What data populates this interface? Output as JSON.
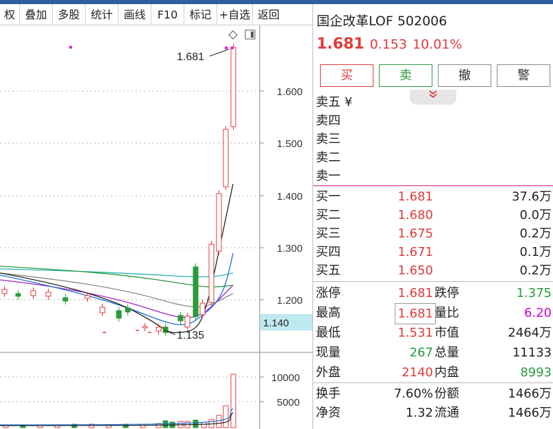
{
  "toolbar": {
    "items": [
      "权",
      "叠加",
      "多股",
      "统计",
      "画线",
      "F10",
      "标记",
      "+自选",
      "返回"
    ]
  },
  "chart": {
    "price_labels": [
      "1.600",
      "1.500",
      "1.400",
      "1.300",
      "1.200"
    ],
    "current_price_label": "1.140",
    "high_marker": "1.681",
    "low_marker": "1.135",
    "volume_labels": [
      "10000",
      "5000"
    ],
    "colors": {
      "up": "#e03a3a",
      "down": "#2a9a3a",
      "ma1": "#222222",
      "ma2": "#1a6fd8",
      "ma3": "#a020c0",
      "ma4": "#888888",
      "ma5": "#2ab0b0",
      "ma6": "#2a9a3a",
      "marker": "#e020e0"
    }
  },
  "chart_data": {
    "type": "candlestick",
    "ylim": [
      1.135,
      1.681
    ],
    "y_ticks": [
      1.6,
      1.5,
      1.4,
      1.3,
      1.2
    ],
    "visible_high": 1.681,
    "visible_low": 1.135,
    "volume_ticks": [
      10000,
      5000
    ]
  },
  "panel": {
    "title": "国企改革LOF 502006",
    "price": "1.681",
    "change": "0.153",
    "pct": "10.01%",
    "buttons": {
      "buy": "买",
      "sell": "卖",
      "cancel": "撤",
      "alert": "警"
    },
    "collapse_icon": "chevron-double-down",
    "asks": [
      {
        "label": "卖五 ¥",
        "price": "",
        "vol": ""
      },
      {
        "label": "卖四",
        "price": "",
        "vol": ""
      },
      {
        "label": "卖三",
        "price": "",
        "vol": ""
      },
      {
        "label": "卖二",
        "price": "",
        "vol": ""
      },
      {
        "label": "卖一",
        "price": "",
        "vol": ""
      }
    ],
    "bids": [
      {
        "label": "买一",
        "price": "1.681",
        "vol": "37.6万"
      },
      {
        "label": "买二",
        "price": "1.680",
        "vol": "0.0万"
      },
      {
        "label": "买三",
        "price": "1.675",
        "vol": "0.2万"
      },
      {
        "label": "买四",
        "price": "1.671",
        "vol": "0.1万"
      },
      {
        "label": "买五",
        "price": "1.650",
        "vol": "0.2万"
      }
    ],
    "stats1": [
      {
        "l": "涨停",
        "v": "1.681",
        "vc": "red",
        "l2": "跌停",
        "v2": "1.375",
        "v2c": "green"
      },
      {
        "l": "最高",
        "v": "1.681",
        "vc": "red",
        "l2": "量比",
        "v2": "6.20",
        "v2c": "mag"
      },
      {
        "l": "最低",
        "v": "1.531",
        "vc": "red",
        "l2": "市值",
        "v2": "2464万",
        "v2c": "blk"
      },
      {
        "l": "现量",
        "v": "267",
        "vc": "green",
        "l2": "总量",
        "v2": "11133",
        "v2c": "blk"
      },
      {
        "l": "外盘",
        "v": "2140",
        "vc": "red",
        "l2": "内盘",
        "v2": "8993",
        "v2c": "green"
      }
    ],
    "stats2": [
      {
        "l": "换手",
        "v": "7.60%",
        "vc": "blk",
        "l2": "份额",
        "v2": "1466万",
        "v2c": "blk"
      },
      {
        "l": "净资",
        "v": "1.32",
        "vc": "blk",
        "l2": "流通",
        "v2": "1466万",
        "v2c": "blk"
      }
    ]
  }
}
